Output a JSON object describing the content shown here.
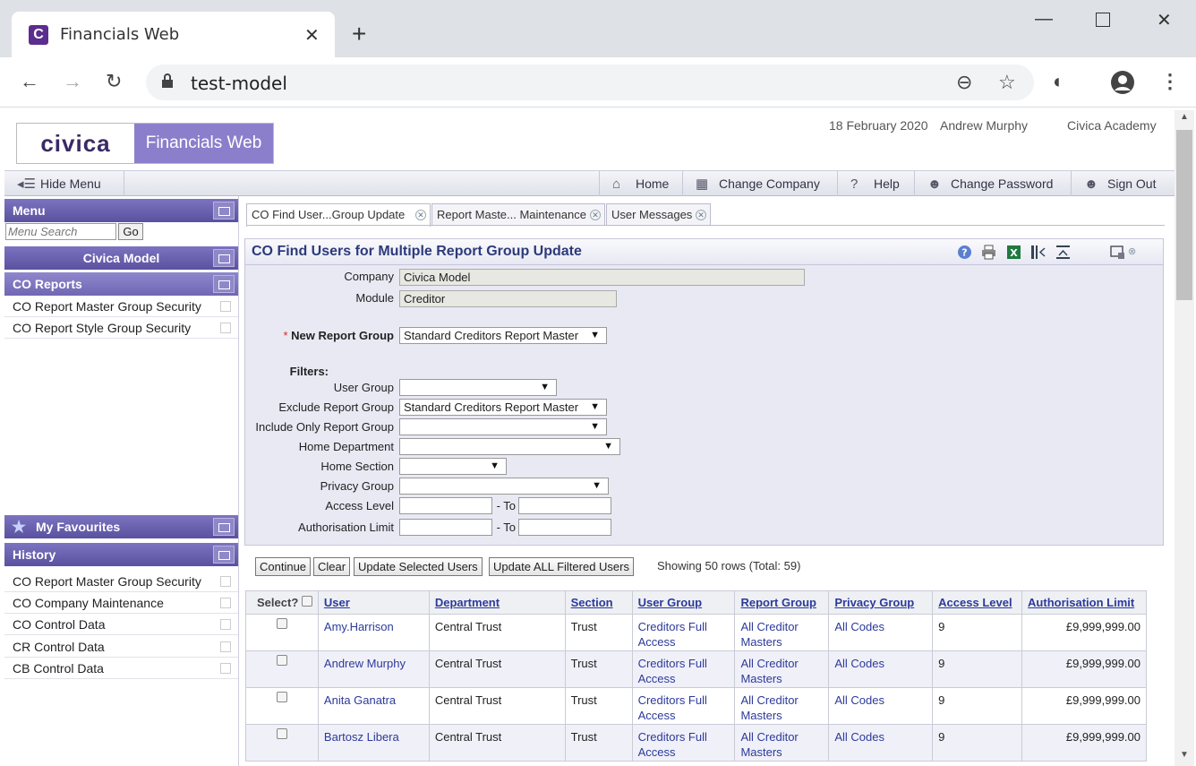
{
  "browser": {
    "tab_title": "Financials Web",
    "url": "test-model"
  },
  "header": {
    "logo_left": "civica",
    "logo_right": "Financials Web",
    "date": "18 February 2020",
    "user": "Andrew Murphy",
    "org": "Civica Academy"
  },
  "nav": {
    "hide_menu": "Hide Menu",
    "home": "Home",
    "change_company": "Change Company",
    "help": "Help",
    "change_password": "Change Password",
    "sign_out": "Sign Out"
  },
  "sidebar": {
    "menu_title": "Menu",
    "search_placeholder": "Menu Search",
    "go": "Go",
    "company": "Civica Model",
    "section": "CO Reports",
    "items": [
      "CO Report Master Group Security",
      "CO Report Style Group Security"
    ],
    "favourites_title": "My Favourites",
    "history_title": "History",
    "history": [
      "CO Report Master Group Security",
      "CO Company Maintenance",
      "CO Control Data",
      "CR Control Data",
      "CB Control Data"
    ]
  },
  "tabs": [
    {
      "label": "CO Find User...Group Update"
    },
    {
      "label": "Report Maste... Maintenance"
    },
    {
      "label": "User Messages"
    }
  ],
  "form": {
    "title": "CO Find Users for Multiple Report Group Update",
    "company_label": "Company",
    "company_value": "Civica Model",
    "module_label": "Module",
    "module_value": "Creditor",
    "required_mark": "*",
    "new_report_group_label": "New Report Group",
    "new_report_group_value": "Standard Creditors Report Master",
    "filters_label": "Filters:",
    "user_group_label": "User Group",
    "exclude_label": "Exclude Report Group",
    "exclude_value": "Standard Creditors Report Master",
    "include_label": "Include Only Report Group",
    "home_dept_label": "Home Department",
    "home_section_label": "Home Section",
    "privacy_label": "Privacy Group",
    "access_label": "Access Level",
    "auth_label": "Authorisation Limit",
    "to_label": "- To"
  },
  "actions": {
    "continue": "Continue",
    "clear": "Clear",
    "update_selected": "Update Selected Users",
    "update_all": "Update ALL Filtered Users",
    "showing": "Showing 50 rows (Total: 59)"
  },
  "table": {
    "columns": [
      "Select?",
      "User",
      "Department",
      "Section",
      "User Group",
      "Report Group",
      "Privacy Group",
      "Access Level",
      "Authorisation Limit"
    ],
    "rows": [
      {
        "user": "Amy.Harrison",
        "department": "Central Trust",
        "section": "Trust",
        "user_group": "Creditors Full Access",
        "report_group": "All Creditor Masters",
        "privacy_group": "All Codes",
        "access_level": "9",
        "auth_limit": "£9,999,999.00"
      },
      {
        "user": "Andrew Murphy",
        "department": "Central Trust",
        "section": "Trust",
        "user_group": "Creditors Full Access",
        "report_group": "All Creditor Masters",
        "privacy_group": "All Codes",
        "access_level": "9",
        "auth_limit": "£9,999,999.00"
      },
      {
        "user": "Anita Ganatra",
        "department": "Central Trust",
        "section": "Trust",
        "user_group": "Creditors Full Access",
        "report_group": "All Creditor Masters",
        "privacy_group": "All Codes",
        "access_level": "9",
        "auth_limit": "£9,999,999.00"
      },
      {
        "user": "Bartosz Libera",
        "department": "Central Trust",
        "section": "Trust",
        "user_group": "Creditors Full Access",
        "report_group": "All Creditor Masters",
        "privacy_group": "All Codes",
        "access_level": "9",
        "auth_limit": "£9,999,999.00"
      }
    ]
  }
}
